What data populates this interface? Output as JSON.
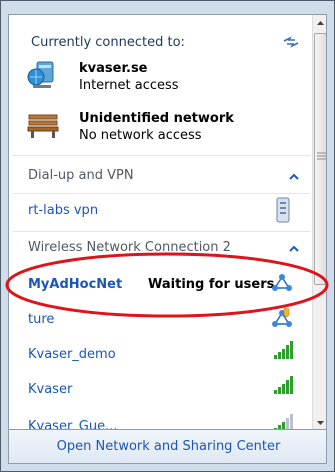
{
  "header": {
    "title": "Currently connected to:"
  },
  "connected": [
    {
      "name": "kvaser.se",
      "status": "Internet access",
      "icon": "network-computer-icon"
    },
    {
      "name": "Unidentified network",
      "status": "No network access",
      "icon": "park-bench-icon"
    }
  ],
  "dialup": {
    "title": "Dial-up and VPN",
    "items": [
      {
        "name": "rt-labs vpn",
        "icon": "vpn-device-icon"
      }
    ]
  },
  "wireless": {
    "title": "Wireless Network Connection 2",
    "items": [
      {
        "name": "MyAdHocNet",
        "status": "Waiting for users",
        "icon": "adhoc-network-icon"
      },
      {
        "name": "ture",
        "icon": "adhoc-shield-network-icon"
      },
      {
        "name": "Kvaser_demo",
        "icon": "signal-bars-icon"
      },
      {
        "name": "Kvaser",
        "icon": "signal-bars-icon"
      },
      {
        "name": "Kvaser_Gue...",
        "icon": "signal-bars-icon"
      }
    ]
  },
  "footer": {
    "link": "Open Network and Sharing Center"
  },
  "colors": {
    "link": "#1b56b6",
    "annotation": "#e0121a",
    "signal": "#2e9e2e"
  }
}
